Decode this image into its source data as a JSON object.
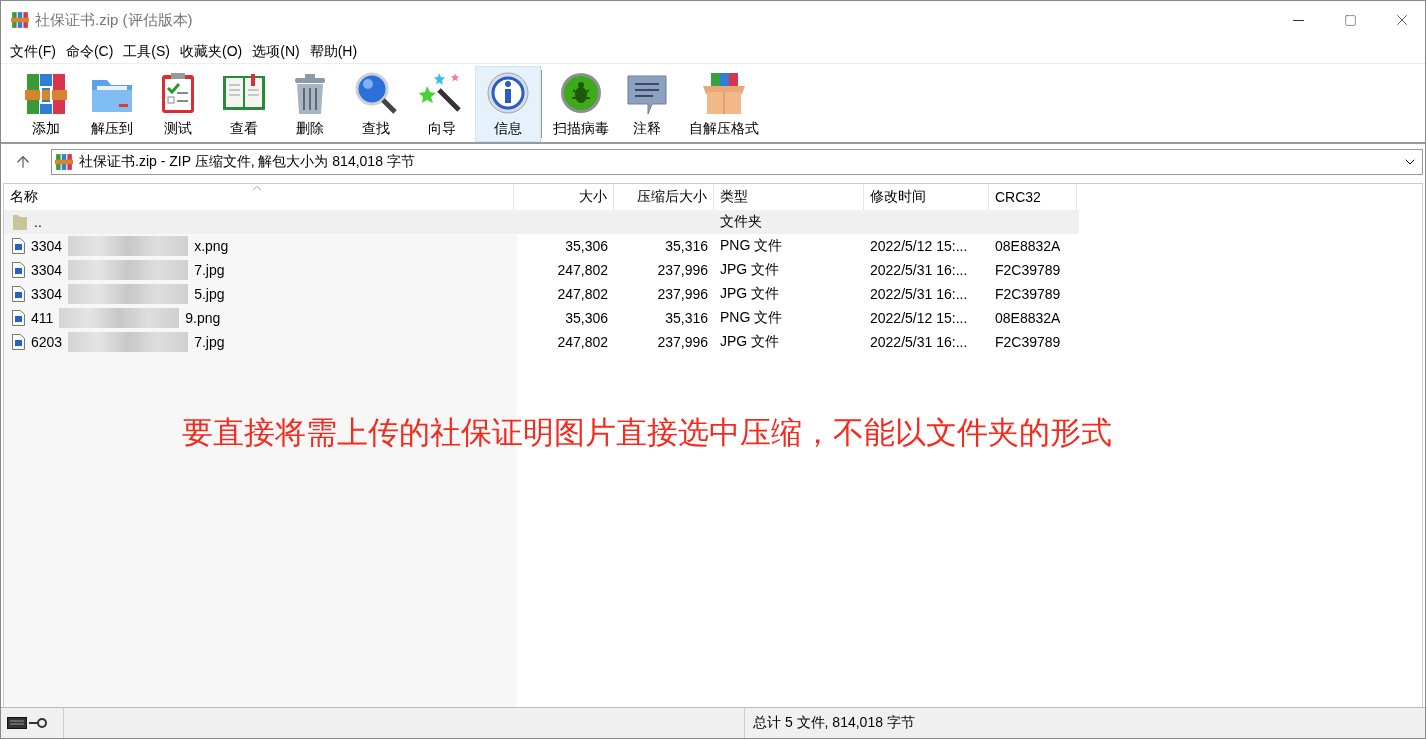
{
  "window": {
    "title": "社保证书.zip (评估版本)"
  },
  "menu": [
    {
      "label": "文件(F)"
    },
    {
      "label": "命令(C)"
    },
    {
      "label": "工具(S)"
    },
    {
      "label": "收藏夹(O)"
    },
    {
      "label": "选项(N)"
    },
    {
      "label": "帮助(H)"
    }
  ],
  "toolbar": [
    {
      "kind": "add",
      "label": "添加",
      "selected": false
    },
    {
      "kind": "extract",
      "label": "解压到",
      "selected": false
    },
    {
      "kind": "test",
      "label": "测试",
      "selected": false
    },
    {
      "kind": "view",
      "label": "查看",
      "selected": false
    },
    {
      "kind": "delete",
      "label": "删除",
      "selected": false
    },
    {
      "kind": "find",
      "label": "查找",
      "selected": false
    },
    {
      "kind": "wizard",
      "label": "向导",
      "selected": false
    },
    {
      "kind": "info",
      "label": "信息",
      "selected": true
    },
    {
      "kind": "virus",
      "label": "扫描病毒",
      "selected": false
    },
    {
      "kind": "comment",
      "label": "注释",
      "selected": false
    },
    {
      "kind": "sfx",
      "label": "自解压格式",
      "selected": false
    }
  ],
  "address": {
    "text": "社保证书.zip - ZIP 压缩文件, 解包大小为 814,018 字节"
  },
  "table": {
    "columns": [
      {
        "label": "名称",
        "sorted": true
      },
      {
        "label": "大小"
      },
      {
        "label": "压缩后大小"
      },
      {
        "label": "类型"
      },
      {
        "label": "修改时间"
      },
      {
        "label": "CRC32"
      }
    ],
    "rows": [
      {
        "kind": "folder",
        "name_start": "..",
        "name_end": "",
        "size": "",
        "packed": "",
        "type": "文件夹",
        "modified": "",
        "crc": ""
      },
      {
        "kind": "image",
        "name_start": "3304",
        "name_end": "x.png",
        "size": "35,306",
        "packed": "35,316",
        "type": "PNG 文件",
        "modified": "2022/5/12 15:...",
        "crc": "08E8832A"
      },
      {
        "kind": "image",
        "name_start": "3304",
        "name_end": "7.jpg",
        "size": "247,802",
        "packed": "237,996",
        "type": "JPG 文件",
        "modified": "2022/5/31 16:...",
        "crc": "F2C39789"
      },
      {
        "kind": "image",
        "name_start": "3304",
        "name_end": "5.jpg",
        "size": "247,802",
        "packed": "237,996",
        "type": "JPG 文件",
        "modified": "2022/5/31 16:...",
        "crc": "F2C39789"
      },
      {
        "kind": "image",
        "name_start": "411",
        "name_end": "9.png",
        "size": "35,306",
        "packed": "35,316",
        "type": "PNG 文件",
        "modified": "2022/5/12 15:...",
        "crc": "08E8832A"
      },
      {
        "kind": "image",
        "name_start": "6203",
        "name_end": "7.jpg",
        "size": "247,802",
        "packed": "237,996",
        "type": "JPG 文件",
        "modified": "2022/5/31 16:...",
        "crc": "F2C39789"
      }
    ]
  },
  "annotation": "要直接将需上传的社保证明图片直接选中压缩，不能以文件夹的形式",
  "status_bar": {
    "text": "总计 5 文件, 814,018 字节"
  }
}
